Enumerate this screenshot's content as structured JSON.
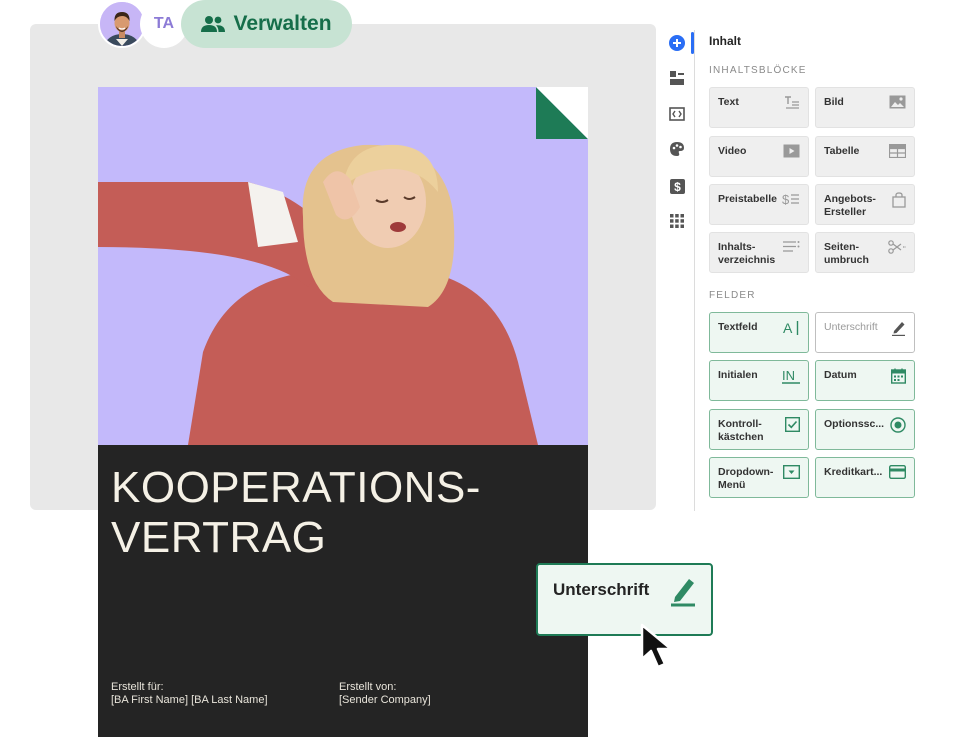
{
  "collaborators": {
    "initials": "TA",
    "manage_label": "Verwalten"
  },
  "document": {
    "title": "KOOPERATIONS-\nVERTRAG",
    "created_for_label": "Erstellt für:",
    "created_for_value": "[BA First Name] [BA Last Name]",
    "created_by_label": "Erstellt von:",
    "created_by_value": "[Sender Company]"
  },
  "floating_field": {
    "label": "Unterschrift"
  },
  "panel": {
    "title": "Inhalt",
    "blocks_heading": "INHALTSBLÖCKE",
    "fields_heading": "FELDER",
    "blocks": [
      {
        "label": "Text",
        "icon": "text-format-icon"
      },
      {
        "label": "Bild",
        "icon": "image-icon"
      },
      {
        "label": "Video",
        "icon": "video-icon"
      },
      {
        "label": "Tabelle",
        "icon": "table-icon"
      },
      {
        "label": "Preistabelle",
        "icon": "pricing-table-icon"
      },
      {
        "label": "Angebots-\nErsteller",
        "icon": "shopping-bag-icon"
      },
      {
        "label": "Inhalts-\nverzeichnis",
        "icon": "table-of-contents-icon"
      },
      {
        "label": "Seiten-\numbruch",
        "icon": "page-break-scissors-icon"
      }
    ],
    "fields": [
      {
        "label": "Textfeld",
        "icon": "text-field-icon"
      },
      {
        "label": "Unterschrift",
        "icon": "signature-pen-icon"
      },
      {
        "label": "Initialen",
        "icon": "initials-icon"
      },
      {
        "label": "Datum",
        "icon": "calendar-icon"
      },
      {
        "label": "Kontroll-\nkästchen",
        "icon": "checkbox-icon"
      },
      {
        "label": "Optionssc...",
        "icon": "radio-button-icon"
      },
      {
        "label": "Dropdown-\nMenü",
        "icon": "dropdown-icon"
      },
      {
        "label": "Kreditkart...",
        "icon": "credit-card-icon"
      }
    ]
  },
  "colors": {
    "accent_green": "#1e7b56",
    "pill_green": "#c7e3d3",
    "cover_purple": "#c3b9fb",
    "cover_dark": "#242424",
    "rail_blue": "#2a6ef5"
  }
}
